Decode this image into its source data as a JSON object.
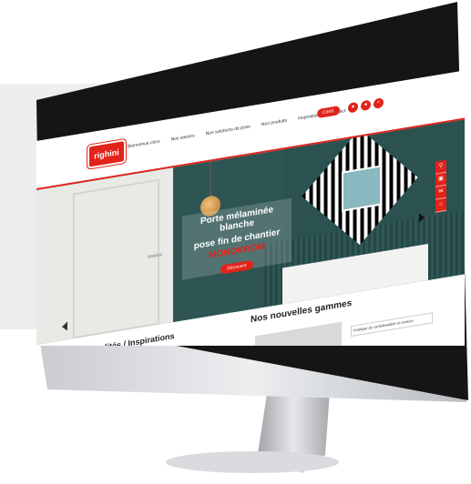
{
  "site": {
    "logo": "righini",
    "nav": [
      "Bienvenue chez",
      "Nos savoirs",
      "Nos solutions de pose",
      "Nos produits",
      "Inspiration",
      "Contact"
    ],
    "certif_label": "Certif."
  },
  "hero": {
    "title_line1": "Porte mélaminée blanche",
    "title_line2": "pose fin de chantier",
    "product": "MONOKROM",
    "button": "Découvrir"
  },
  "sections": {
    "left_title": "Actualités / Inspirations",
    "right_title": "Nos nouvelles gammes",
    "privacy": "Politique de confidentialité et cookies"
  },
  "colors": {
    "brand": "#e2231a",
    "hero_bg": "#2e5554"
  },
  "icons": {
    "header": [
      "user-icon",
      "user-icon",
      "share-icon"
    ],
    "side": [
      "search-icon",
      "document-icon",
      "mail-icon",
      "home-icon"
    ]
  }
}
